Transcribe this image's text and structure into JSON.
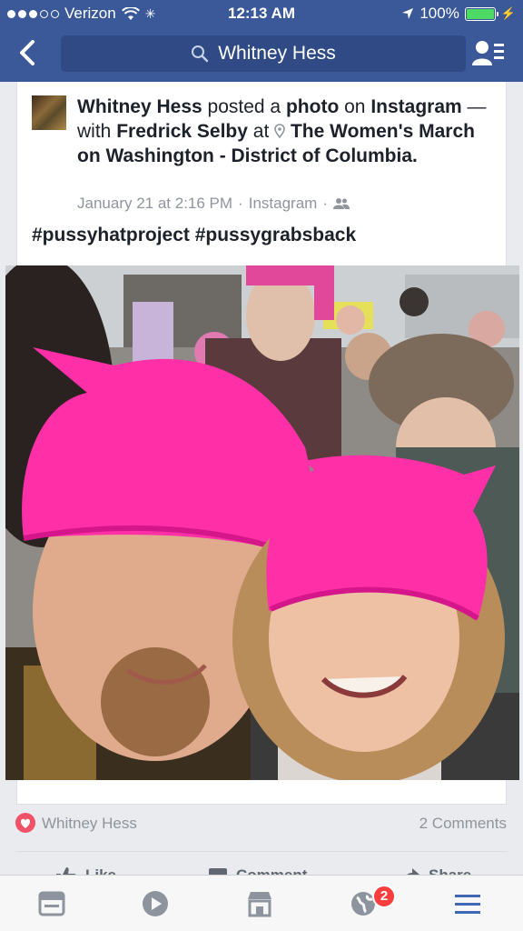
{
  "status_bar": {
    "carrier": "Verizon",
    "time": "12:13 AM",
    "battery_percent": "100%",
    "signal_bars_filled": 3,
    "signal_bars_total": 5
  },
  "nav": {
    "search_value": "Whitney Hess",
    "icons": [
      "back-chevron-icon",
      "search-icon",
      "friend-list-icon"
    ]
  },
  "post": {
    "author": "Whitney Hess",
    "text_posted_a": "posted a",
    "text_photo": "photo",
    "text_on": "on",
    "source": "Instagram",
    "text_with": "— with",
    "tagged": "Fredrick Selby",
    "text_at": "at",
    "location": "The Women's March on Washington - District of Columbia.",
    "timestamp": "January 21 at 2:16 PM",
    "via": "Instagram",
    "privacy_icon": "friends-icon",
    "hashtags": "#pussyhatproject #pussygrabsback"
  },
  "reactions": {
    "reacted_by": "Whitney Hess",
    "comments": "2 Comments",
    "actions": [
      {
        "label": "Like",
        "icon": "thumbs-up-icon"
      },
      {
        "label": "Comment",
        "icon": "comment-icon"
      },
      {
        "label": "Share",
        "icon": "share-icon"
      }
    ]
  },
  "tabbar": {
    "tabs": [
      "news-feed-icon",
      "video-icon",
      "marketplace-icon",
      "notifications-globe-icon",
      "menu-icon"
    ],
    "notifications_badge": "2",
    "active_color": "#4267b2",
    "inactive_color": "#8d949e"
  },
  "colors": {
    "brand_blue": "#3b5998",
    "battery_green": "#4cd964",
    "badge_red": "#fa3e3e",
    "heart_red": "#f25268",
    "hat_pink": "#ff2fa8"
  }
}
